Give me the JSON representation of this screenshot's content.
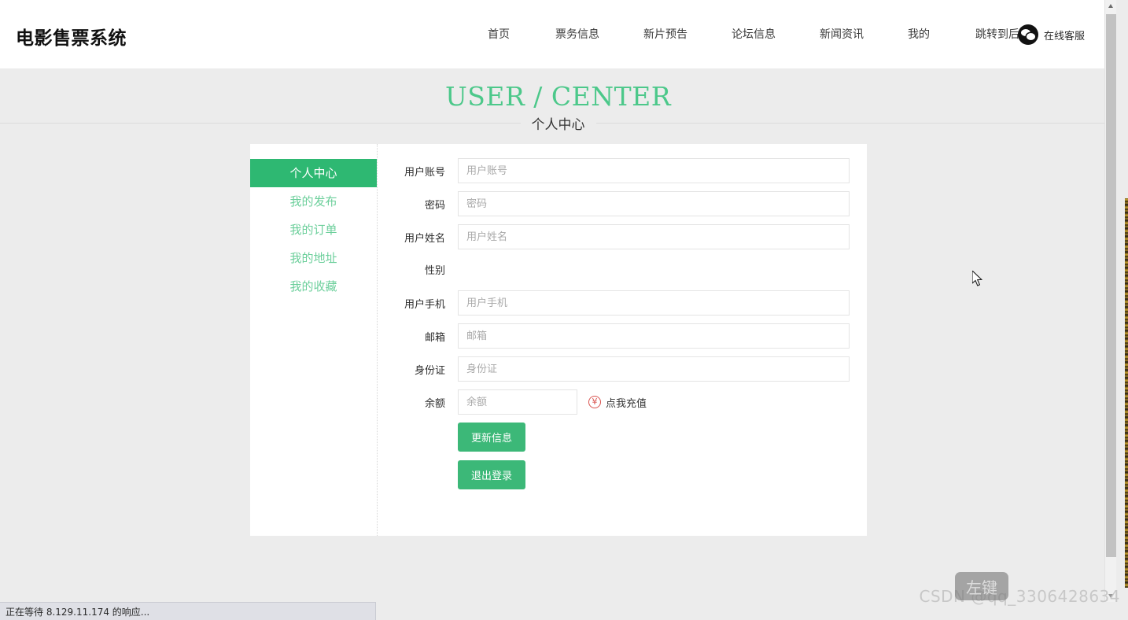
{
  "site": {
    "brand": "电影售票系统"
  },
  "nav": {
    "items": [
      {
        "label": "首页",
        "name": "nav-home"
      },
      {
        "label": "票务信息",
        "name": "nav-ticket-info"
      },
      {
        "label": "新片预告",
        "name": "nav-new-trailers"
      },
      {
        "label": "论坛信息",
        "name": "nav-forum"
      },
      {
        "label": "新闻资讯",
        "name": "nav-news"
      },
      {
        "label": "我的",
        "name": "nav-mine"
      },
      {
        "label": "跳转到后台",
        "name": "nav-admin"
      }
    ],
    "service": {
      "label": "在线客服",
      "icon": "wechat-chat-icon"
    }
  },
  "page_title": {
    "english": "USER / CENTER",
    "chinese": "个人中心",
    "accent_color": "#4cc88a"
  },
  "sidebar": {
    "items": [
      {
        "label": "个人中心",
        "active": true
      },
      {
        "label": "我的发布",
        "active": false
      },
      {
        "label": "我的订单",
        "active": false
      },
      {
        "label": "我的地址",
        "active": false
      },
      {
        "label": "我的收藏",
        "active": false
      }
    ],
    "active_bg": "#2eb872",
    "link_color": "#6ccf9b"
  },
  "form": {
    "fields": [
      {
        "label": "用户账号",
        "placeholder": "用户账号",
        "value": "",
        "type": "text",
        "name": "user-account"
      },
      {
        "label": "密码",
        "placeholder": "密码",
        "value": "",
        "type": "password",
        "name": "password"
      },
      {
        "label": "用户姓名",
        "placeholder": "用户姓名",
        "value": "",
        "type": "text",
        "name": "user-name"
      },
      {
        "label": "性别",
        "placeholder": "",
        "value": "",
        "type": "radio-empty",
        "name": "gender"
      },
      {
        "label": "用户手机",
        "placeholder": "用户手机",
        "value": "",
        "type": "text",
        "name": "user-phone"
      },
      {
        "label": "邮箱",
        "placeholder": "邮箱",
        "value": "",
        "type": "text",
        "name": "email"
      },
      {
        "label": "身份证",
        "placeholder": "身份证",
        "value": "",
        "type": "text",
        "name": "id-card"
      },
      {
        "label": "余额",
        "placeholder": "余额",
        "value": "",
        "type": "text-narrow",
        "name": "balance"
      }
    ],
    "recharge": {
      "label": "点我充值",
      "icon": "yen-circle-icon",
      "icon_glyph": "¥",
      "icon_color": "#d9534f"
    },
    "buttons": [
      {
        "label": "更新信息",
        "name": "update-info-button"
      },
      {
        "label": "退出登录",
        "name": "logout-button"
      }
    ],
    "button_color": "#3cb878"
  },
  "browser": {
    "status_text": "正在等待 8.129.11.174 的响应..."
  },
  "overlay": {
    "watermark": "CSDN @qq_3306428634",
    "click_badge": "左键"
  }
}
